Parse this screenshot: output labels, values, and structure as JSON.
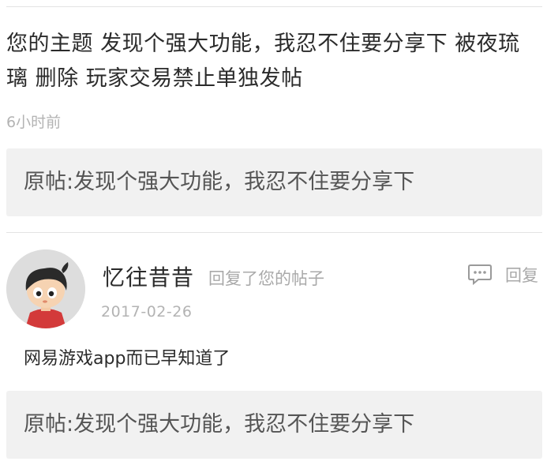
{
  "notification": {
    "text": "您的主题 发现个强大功能，我忍不住要分享下 被夜琉璃 删除 玩家交易禁止单独发帖",
    "time": "6小时前",
    "quote": "原帖:发现个强大功能，我忍不住要分享下"
  },
  "reply": {
    "username": "忆往昔昔",
    "action": "回复了您的帖子",
    "reply_label": "回复",
    "reply_icon": "comment-bubble-icon",
    "date": "2017-02-26",
    "content": "网易游戏app而已早知道了",
    "quote": "原帖:发现个强大功能，我忍不住要分享下"
  },
  "colors": {
    "primary_text": "#2b2b2b",
    "secondary_text": "#a9a9a9",
    "quote_bg": "#f1f1f1"
  }
}
